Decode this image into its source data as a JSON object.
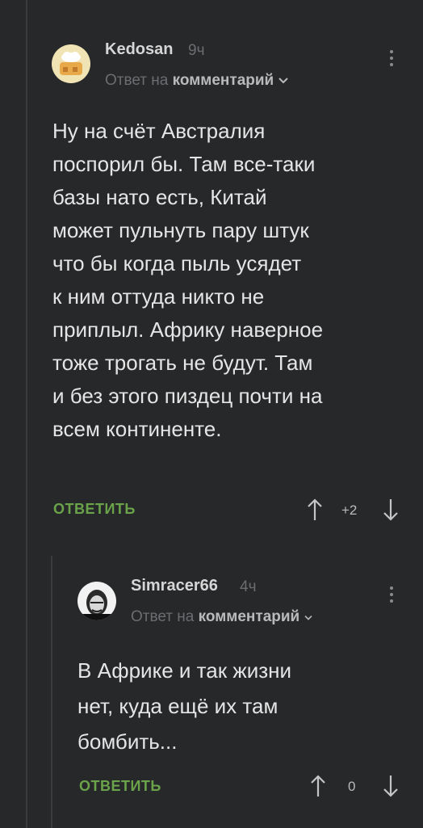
{
  "comments": [
    {
      "author": "Kedosan",
      "time": "9ч",
      "reply_prefix": "Ответ на",
      "reply_target": "комментарий",
      "body_lines": [
        "Ну на счёт Австралия",
        "поспорил бы. Там все-таки",
        "базы нато есть, Китай",
        "может пульнуть пару штук",
        "что бы когда пыль усядет",
        "к ним оттуда никто не",
        "приплыл. Африку наверное",
        "тоже трогать не будут. Там",
        "и без этого пиздец почти на",
        "всем континенте."
      ],
      "reply_label": "ОТВЕТИТЬ",
      "score": "+2"
    },
    {
      "author": "Simracer66",
      "time": "4ч",
      "reply_prefix": "Ответ на",
      "reply_target": "комментарий",
      "body_lines": [
        "В Африке и так жизни",
        "нет, куда ещё их там",
        "бомбить..."
      ],
      "reply_label": "ОТВЕТИТЬ",
      "score": "0"
    }
  ],
  "colors": {
    "background": "#27282a",
    "reply_button": "#6aa34a",
    "muted_text": "#6c6d70"
  }
}
